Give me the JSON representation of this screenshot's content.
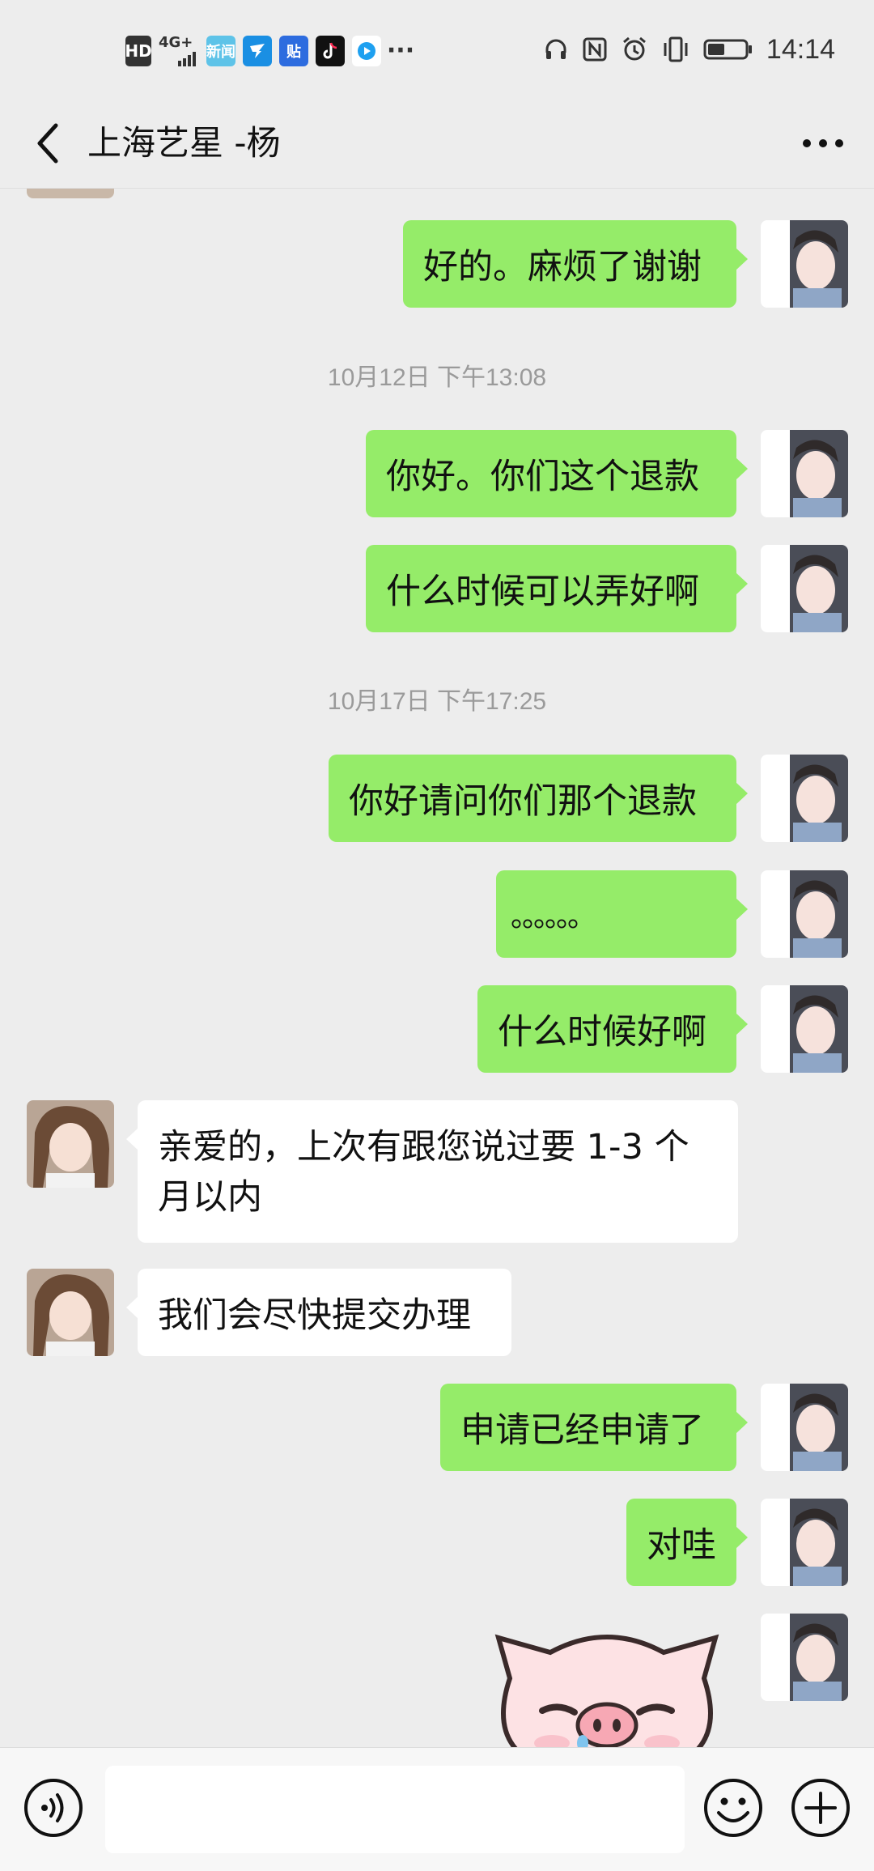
{
  "status_bar": {
    "left_icons": [
      "HD",
      "4G+",
      "新闻",
      "",
      "贴",
      "",
      ""
    ],
    "time": "14:14"
  },
  "header": {
    "title": "上海艺星 -杨"
  },
  "messages": {
    "m1": "好的。麻烦了谢谢",
    "ts1": "10月12日 下午13:08",
    "m2": "你好。你们这个退款",
    "m3": "什么时候可以弄好啊",
    "ts2": "10月17日 下午17:25",
    "m4": "你好请问你们那个退款",
    "m5": "。。。。。。",
    "m6": "什么时候好啊",
    "m7": "亲爱的，上次有跟您说过要 1-3 个月以内",
    "m8": "我们会尽快提交办理",
    "m9": "申请已经申请了",
    "m10": "对哇"
  },
  "colors": {
    "outgoing_bubble": "#95ec69",
    "incoming_bubble": "#ffffff",
    "chat_background": "#ededed"
  },
  "input": {
    "placeholder": ""
  }
}
